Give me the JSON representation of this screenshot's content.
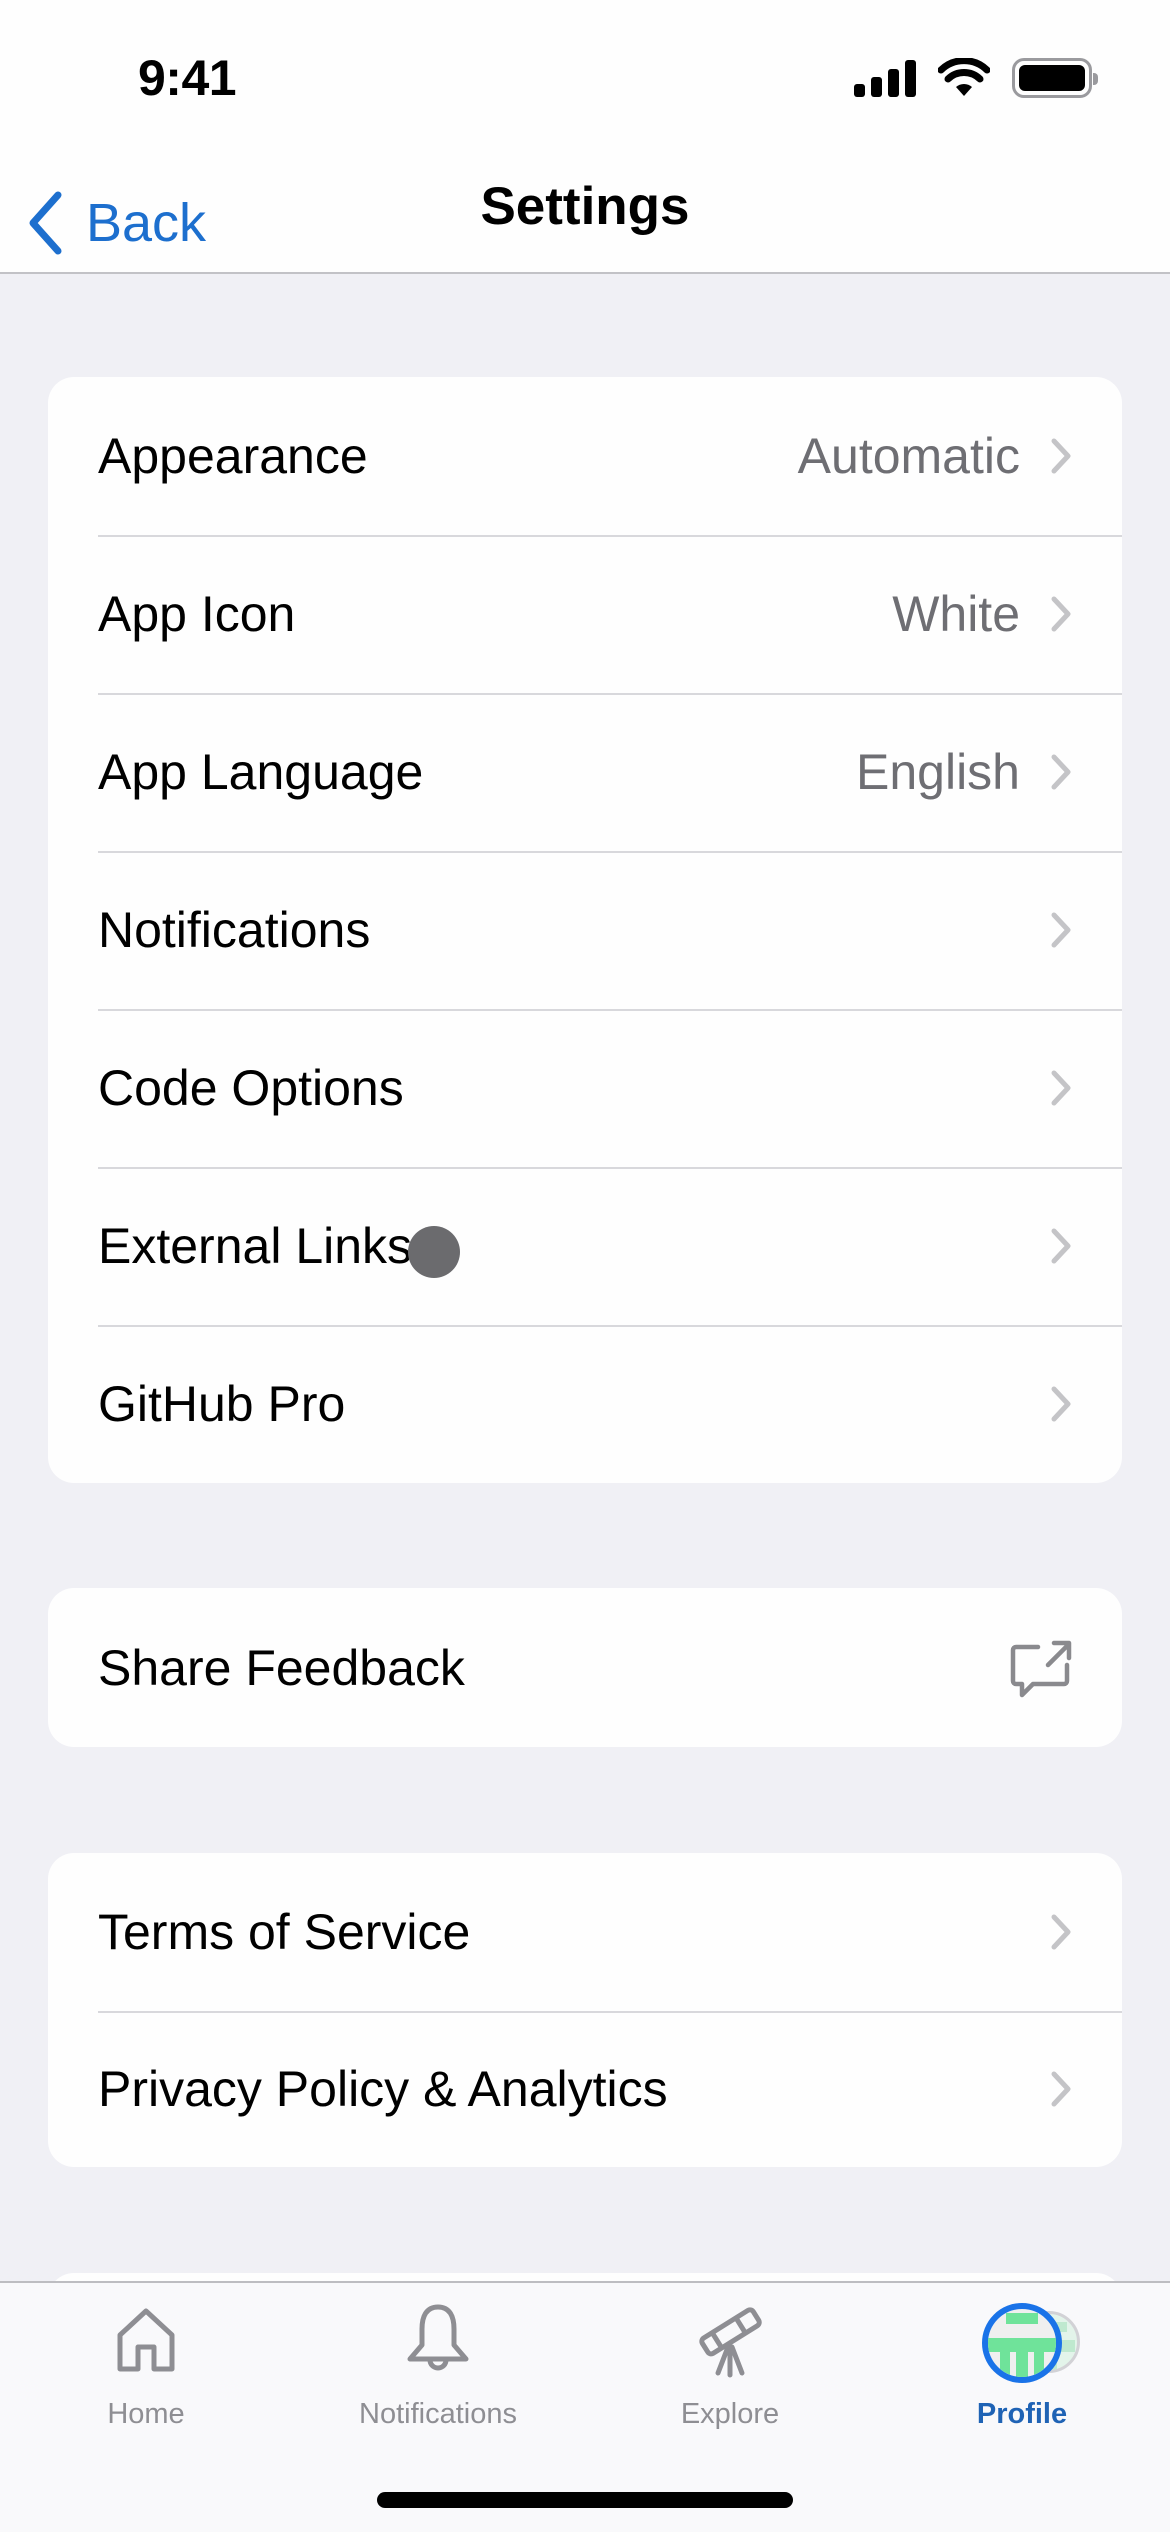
{
  "status_bar": {
    "time": "9:41",
    "icons": [
      "cellular-signal-icon",
      "wifi-icon",
      "battery-icon"
    ]
  },
  "nav": {
    "back_label": "Back",
    "back_icon": "chevron-left-icon",
    "title": "Settings"
  },
  "sections": [
    {
      "rows": [
        {
          "label": "Appearance",
          "value": "Automatic",
          "accessory": "chevron-right-icon"
        },
        {
          "label": "App Icon",
          "value": "White",
          "accessory": "chevron-right-icon"
        },
        {
          "label": "App Language",
          "value": "English",
          "accessory": "chevron-right-icon"
        },
        {
          "label": "Notifications",
          "value": "",
          "accessory": "chevron-right-icon"
        },
        {
          "label": "Code Options",
          "value": "",
          "accessory": "chevron-right-icon"
        },
        {
          "label": "External Links",
          "value": "",
          "accessory": "chevron-right-icon"
        },
        {
          "label": "GitHub Pro",
          "value": "",
          "accessory": "chevron-right-icon"
        }
      ]
    },
    {
      "rows": [
        {
          "label": "Share Feedback",
          "value": "",
          "accessory": "share-feedback-icon"
        }
      ]
    },
    {
      "rows": [
        {
          "label": "Terms of Service",
          "value": "",
          "accessory": "chevron-right-icon"
        },
        {
          "label": "Privacy Policy & Analytics",
          "value": "",
          "accessory": "chevron-right-icon"
        }
      ]
    }
  ],
  "tab_bar": {
    "tabs": [
      {
        "label": "Home",
        "icon": "home-icon",
        "active": false
      },
      {
        "label": "Notifications",
        "icon": "bell-icon",
        "active": false
      },
      {
        "label": "Explore",
        "icon": "telescope-icon",
        "active": false
      },
      {
        "label": "Profile",
        "icon": "avatar-icon",
        "active": true
      }
    ]
  },
  "colors": {
    "accent": "#1d6fce",
    "active_tab": "#1f63b5",
    "background": "#f0f0f5",
    "secondary_text": "#6e6e73",
    "chevron": "#c4c4c7",
    "tab_inactive": "#8e8e93",
    "avatar_ring": "#1a73e8",
    "identicon": "#6fe39a"
  }
}
